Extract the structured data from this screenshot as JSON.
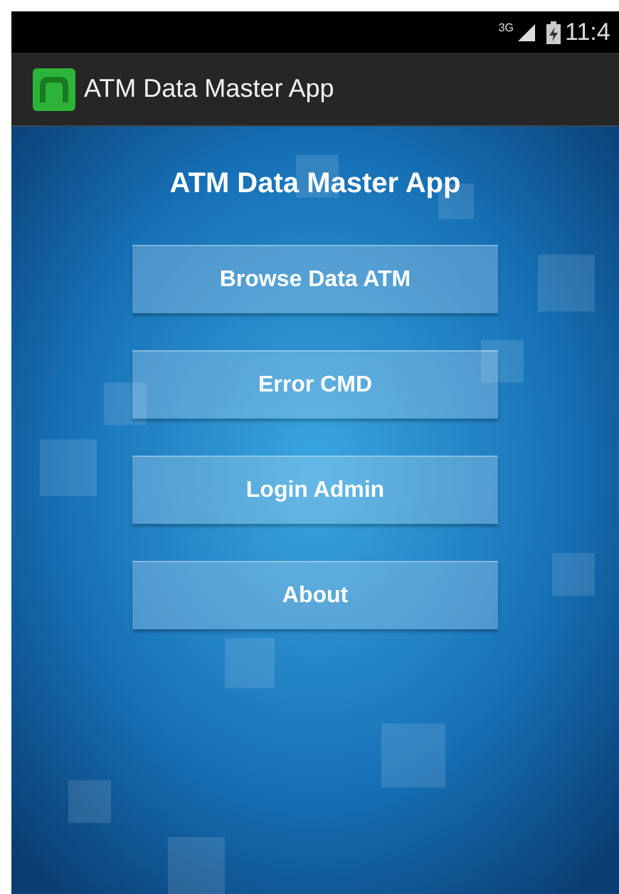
{
  "status_bar": {
    "network": "3G",
    "time": "11:4"
  },
  "action_bar": {
    "title": "ATM Data Master App"
  },
  "heading": "ATM Data Master App",
  "buttons": [
    {
      "label": "Browse Data ATM"
    },
    {
      "label": "Error CMD"
    },
    {
      "label": "Login Admin"
    },
    {
      "label": "About"
    }
  ]
}
